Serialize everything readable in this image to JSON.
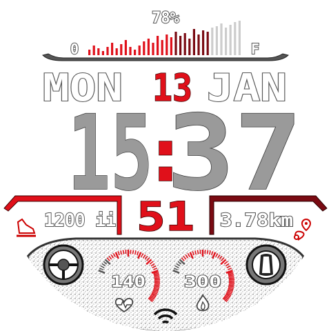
{
  "battery": {
    "percent_label": "78%",
    "level": 78,
    "empty_label": "0",
    "full_label": "F"
  },
  "date": {
    "weekday": "MON",
    "day": "13",
    "month": "JAN"
  },
  "time": {
    "hours": "15",
    "separator": ":",
    "minutes": "37"
  },
  "stats": {
    "steps": "1200 ii",
    "seconds": "51",
    "distance": "3.78km"
  },
  "gauges": {
    "heart_rate_value": "140",
    "secondary_value": "300"
  },
  "icons": {
    "steps": "shoe-icon",
    "distance": "route-pin-icon",
    "left_wheel": "steering-wheel-icon",
    "right_wheel": "tire-icon",
    "heart": "heart-icon",
    "calories": "flame-icon",
    "wifi": "wifi-icon"
  },
  "colors": {
    "accent": "#e0101a",
    "dark_accent": "#7a0a12",
    "segment_grey": "#9a9a9a"
  }
}
